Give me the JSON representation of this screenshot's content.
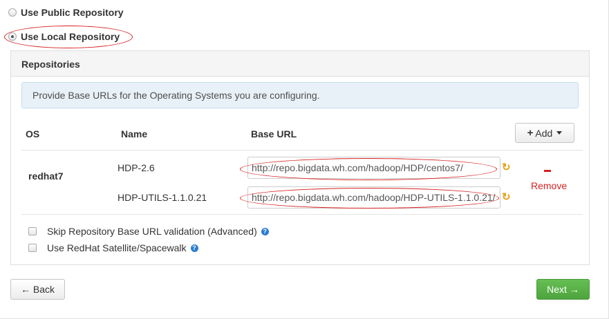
{
  "repo_choice": {
    "public_label": "Use Public Repository",
    "local_label": "Use Local Repository",
    "selected": "local"
  },
  "panel": {
    "title": "Repositories",
    "info": "Provide Base URLs for the Operating Systems you are configuring."
  },
  "table": {
    "headers": {
      "os": "OS",
      "name": "Name",
      "base_url": "Base URL"
    },
    "add_label": "Add",
    "rows": [
      {
        "os": "redhat7",
        "repos": [
          {
            "name": "HDP-2.6",
            "url": "http://repo.bigdata.wh.com/hadoop/HDP/centos7/"
          },
          {
            "name": "HDP-UTILS-1.1.0.21",
            "url": "http://repo.bigdata.wh.com/hadoop/HDP-UTILS-1.1.0.21/"
          }
        ],
        "remove_label": "Remove"
      }
    ]
  },
  "options": {
    "skip_validation_label": "Skip Repository Base URL validation (Advanced)",
    "satellite_label": "Use RedHat Satellite/Spacewalk",
    "help_glyph": "?"
  },
  "nav": {
    "back_label": "← Back",
    "next_label": "Next →"
  },
  "colors": {
    "annotation": "#d62020",
    "next_button": "#5cb85c",
    "info_background": "#e8f1f8",
    "refresh_icon": "#e8a013"
  }
}
